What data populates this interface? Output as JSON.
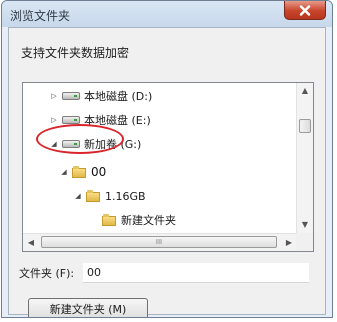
{
  "dialog": {
    "title": "浏览文件夹",
    "description": "支持文件夹数据加密",
    "close_icon": "close-icon"
  },
  "tree": {
    "nodes": [
      {
        "label": "本地磁盘 (D:)",
        "icon": "drive-icon",
        "expanded": false
      },
      {
        "label": "本地磁盘 (E:)",
        "icon": "drive-icon",
        "expanded": false
      },
      {
        "label": "新加卷 (G:)",
        "icon": "drive-icon",
        "expanded": true
      },
      {
        "label": "00",
        "icon": "folder-icon",
        "expanded": true,
        "selected": true
      },
      {
        "label": "1.16GB",
        "icon": "folder-icon",
        "expanded": true
      },
      {
        "label": "新建文件夹",
        "icon": "folder-icon",
        "expanded": false
      }
    ],
    "hscroll_grip": "III"
  },
  "folder_field": {
    "label": "文件夹 (F):",
    "value": "00"
  },
  "buttons": {
    "new_folder": "新建文件夹 (M)"
  },
  "colors": {
    "highlight_ring": "#d8262c",
    "close_button": "#c8452c"
  }
}
